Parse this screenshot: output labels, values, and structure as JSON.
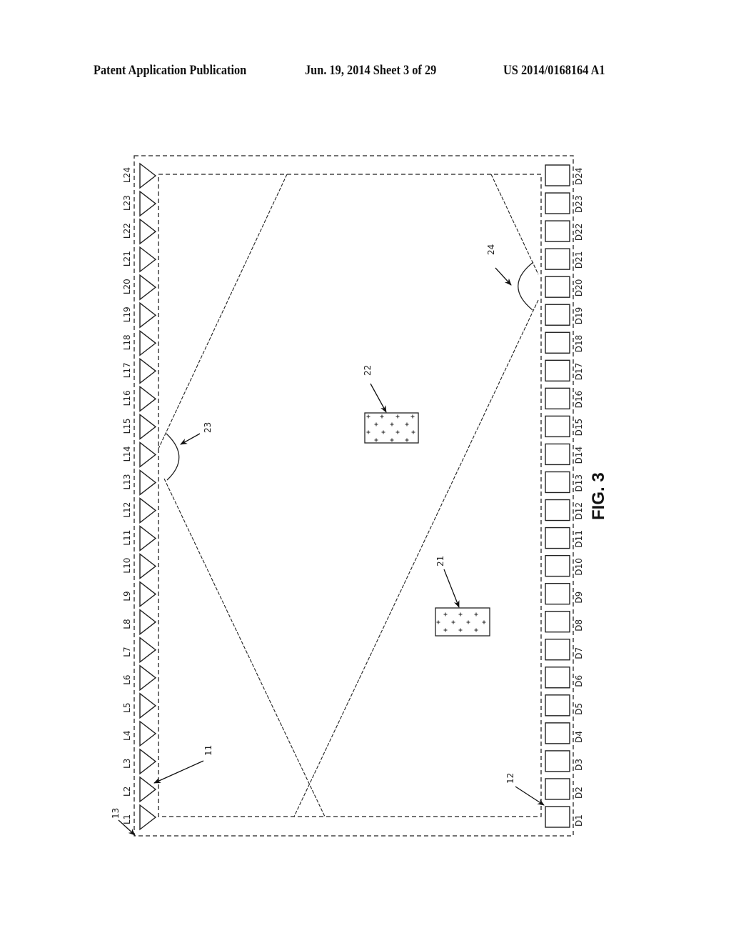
{
  "header": {
    "publication": "Patent Application Publication",
    "date_sheet": "Jun. 19, 2014  Sheet 3 of 29",
    "patent_number": "US 2014/0168164 A1"
  },
  "figure": {
    "label": "FIG. 3",
    "emitters": [
      "L1",
      "L2",
      "L3",
      "L4",
      "L5",
      "L6",
      "L7",
      "L8",
      "L9",
      "L10",
      "L11",
      "L12",
      "L13",
      "L14",
      "L15",
      "L16",
      "L17",
      "L18",
      "L19",
      "L20",
      "L21",
      "L22",
      "L23",
      "L24"
    ],
    "detectors": [
      "D1",
      "D2",
      "D3",
      "D4",
      "D5",
      "D6",
      "D7",
      "D8",
      "D9",
      "D10",
      "D11",
      "D12",
      "D13",
      "D14",
      "D15",
      "D16",
      "D17",
      "D18",
      "D19",
      "D20",
      "D21",
      "D22",
      "D23",
      "D24"
    ],
    "reference_numerals": {
      "emitter_array": "11",
      "detector_array": "12",
      "frame": "13",
      "object_a": "21",
      "object_b": "22",
      "angle_a": "23",
      "angle_b": "24"
    }
  }
}
